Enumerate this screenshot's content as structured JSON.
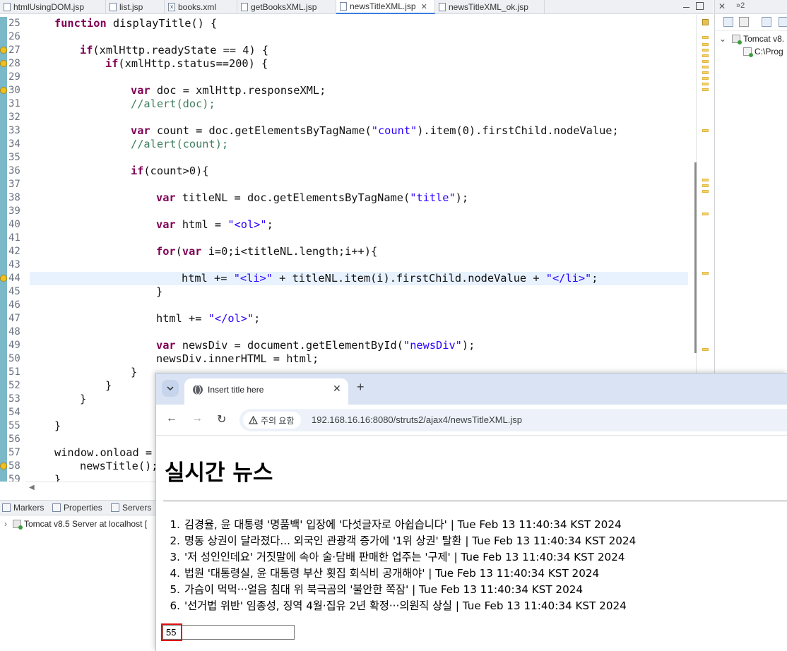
{
  "editor_tabs": [
    {
      "label": "htmlUsingDOM.jsp",
      "icon": "jsp-file-icon"
    },
    {
      "label": "list.jsp",
      "icon": "jsp-file-icon"
    },
    {
      "label": "books.xml",
      "icon": "xml-file-icon"
    },
    {
      "label": "getBooksXML.jsp",
      "icon": "jsp-file-icon"
    },
    {
      "label": "newsTitleXML.jsp",
      "icon": "jsp-file-icon",
      "active": true
    },
    {
      "label": "newsTitleXML_ok.jsp",
      "icon": "jsp-file-icon"
    }
  ],
  "editor": {
    "line_numbers": [
      "25",
      "26",
      "27",
      "28",
      "29",
      "30",
      "31",
      "32",
      "33",
      "34",
      "35",
      "36",
      "37",
      "38",
      "39",
      "40",
      "41",
      "42",
      "43",
      "44",
      "45",
      "46",
      "47",
      "48",
      "49",
      "50",
      "51",
      "52",
      "53",
      "54",
      "55",
      "56",
      "57",
      "58",
      "59"
    ],
    "warning_lines": [
      "27",
      "28",
      "30",
      "44",
      "58"
    ],
    "highlighted_line": "44",
    "code": {
      "l25_kw": "function",
      "l25_rest": " displayTitle() {",
      "l27_kw": "if",
      "l27_rest": "(xmlHttp.readyState == 4) {",
      "l28_kw": "if",
      "l28_rest": "(xmlHttp.status==200) {",
      "l30_kw": "var",
      "l30_rest": " doc = xmlHttp.responseXML;",
      "l31_cmt": "//alert(doc);",
      "l33_kw": "var",
      "l33_a": " count = doc.getElementsByTagName(",
      "l33_str": "\"count\"",
      "l33_b": ").item(0).firstChild.nodeValue;",
      "l34_cmt": "//alert(count);",
      "l36_kw": "if",
      "l36_rest": "(count>0){",
      "l38_kw": "var",
      "l38_a": " titleNL = doc.getElementsByTagName(",
      "l38_str": "\"title\"",
      "l38_b": ");",
      "l40_kw": "var",
      "l40_a": " html = ",
      "l40_str": "\"<ol>\"",
      "l40_b": ";",
      "l42_kw1": "for",
      "l42_a": "(",
      "l42_kw2": "var",
      "l42_b": " i=0;i<titleNL.length;i++){",
      "l44_a": "html += ",
      "l44_str1": "\"<li>\"",
      "l44_b": " + titleNL.item(i).firstChild.nodeValue + ",
      "l44_str2": "\"</li>\"",
      "l44_c": ";",
      "l45": "}",
      "l47_a": "html += ",
      "l47_str": "\"</ol>\"",
      "l47_b": ";",
      "l49_kw": "var",
      "l49_a": " newsDiv = document.getElementById(",
      "l49_str": "\"newsDiv\"",
      "l49_b": ");",
      "l50": "newsDiv.innerHTML = html;",
      "l51": "}",
      "l52": "}",
      "l53": "}",
      "l55": "}",
      "l57": "window.onload =",
      "l58": "newsTitle();",
      "l59": "}"
    }
  },
  "servers_view": {
    "tab_label": "»2",
    "tree": [
      {
        "label": "Tomcat v8.",
        "expanded": true
      },
      {
        "label": "C:\\Prog"
      }
    ]
  },
  "bottom_panel": {
    "tabs": [
      {
        "label": "Markers",
        "icon": "markers-icon"
      },
      {
        "label": "Properties",
        "icon": "properties-icon"
      },
      {
        "label": "Servers",
        "icon": "servers-icon",
        "active": true
      }
    ],
    "server_entry": "Tomcat v8.5 Server at localhost  ["
  },
  "browser": {
    "tab_title": "Insert title here",
    "security_label": "주의 요함",
    "url": "192.168.16.16:8080/struts2/ajax4/newsTitleXML.jsp",
    "page": {
      "heading": "실시간 뉴스",
      "news": [
        {
          "num": "1.",
          "text": "김경율, 윤 대통령 '명품백' 입장에 '다섯글자로 아쉽습니다' | Tue Feb 13 11:40:34 KST 2024"
        },
        {
          "num": "2.",
          "text": "명동 상권이 달라졌다... 외국인 관광객 증가에 '1위 상권' 탈환 | Tue Feb 13 11:40:34 KST 2024"
        },
        {
          "num": "3.",
          "text": "'저 성인인데요' 거짓말에 속아 술·담배 판매한 업주는 '구제' | Tue Feb 13 11:40:34 KST 2024"
        },
        {
          "num": "4.",
          "text": "법원 '대통령실, 윤 대통령 부산 횟집 회식비 공개해야' | Tue Feb 13 11:40:34 KST 2024"
        },
        {
          "num": "5.",
          "text": "가슴이 먹먹···얼음 침대 위 북극곰의 '불안한 쪽잠' | Tue Feb 13 11:40:34 KST 2024"
        },
        {
          "num": "6.",
          "text": "'선거법 위반' 임종성, 징역 4월·집유 2년 확정···의원직 상실 | Tue Feb 13 11:40:34 KST 2024"
        }
      ],
      "count_value": "55"
    }
  },
  "colors": {
    "keyword": "#7f0055",
    "string": "#2a00ff",
    "comment": "#3f7f5f",
    "highlight_marker": "#e01010"
  }
}
